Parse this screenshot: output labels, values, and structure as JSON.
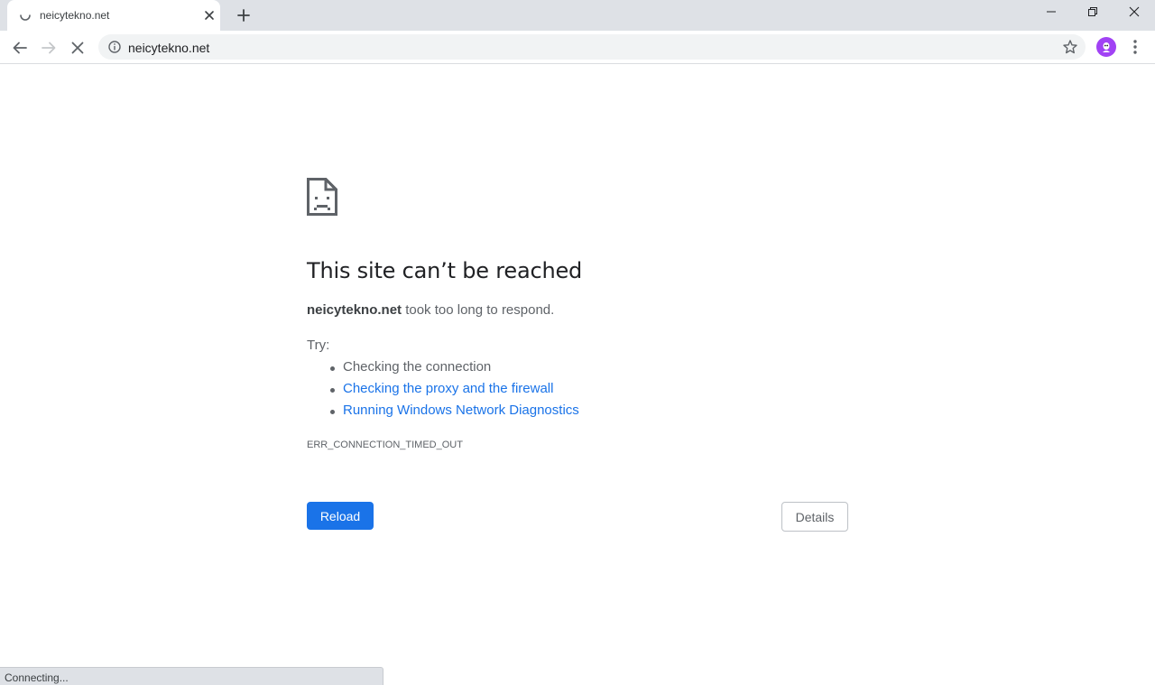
{
  "tab": {
    "title": "neicytekno.net",
    "loading_icon": "loading-spinner-icon",
    "close_icon": "close-icon"
  },
  "new_tab_icon": "plus-icon",
  "window_controls": {
    "minimize_icon": "minimize-icon",
    "restore_icon": "restore-icon",
    "close_icon": "close-icon"
  },
  "toolbar": {
    "back_icon": "back-arrow-icon",
    "forward_icon": "forward-arrow-icon",
    "stop_icon": "stop-icon",
    "url": "neicytekno.net",
    "site_info_icon": "info-icon",
    "bookmark_icon": "star-icon",
    "profile_icon": "avatar",
    "menu_icon": "vertical-dots-icon"
  },
  "error_page": {
    "icon": "sad-page-icon",
    "title": "This site can’t be reached",
    "host": "neicytekno.net",
    "description_suffix": " took too long to respond.",
    "try_label": "Try:",
    "suggestions": [
      {
        "text": "Checking the connection",
        "is_link": false
      },
      {
        "text": "Checking the proxy and the firewall",
        "is_link": true
      },
      {
        "text": "Running Windows Network Diagnostics",
        "is_link": true
      }
    ],
    "error_code": "ERR_CONNECTION_TIMED_OUT",
    "reload_label": "Reload",
    "details_label": "Details"
  },
  "status_bar": {
    "text": "Connecting..."
  },
  "colors": {
    "accent": "#1a73e8",
    "tabstrip_bg": "#dee1e6",
    "omnibox_bg": "#f1f3f4",
    "text_primary": "#202124",
    "text_secondary": "#5f6368",
    "avatar": "#a142f4"
  }
}
